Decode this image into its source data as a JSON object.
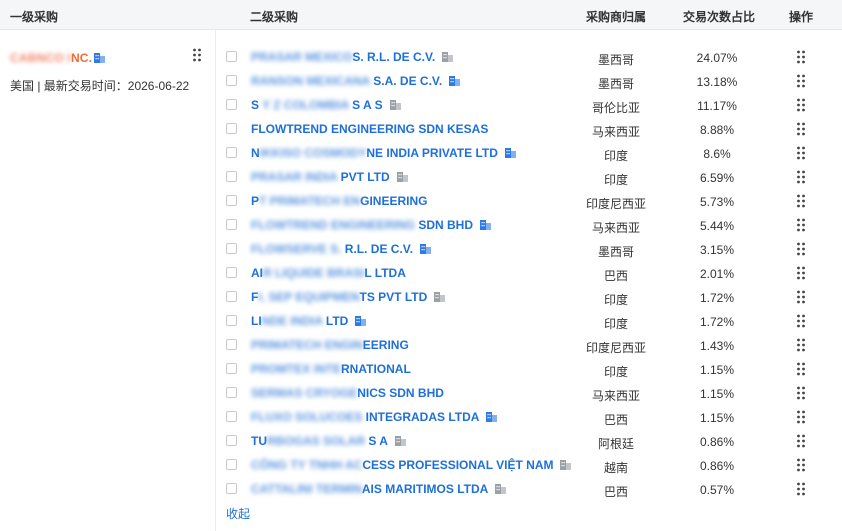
{
  "header": {
    "col_primary": "一级采购",
    "col_secondary": "二级采购",
    "col_country": "采购商归属",
    "col_share": "交易次数占比",
    "col_action": "操作"
  },
  "primary": {
    "name_hidden": "CABNCO I",
    "name_visible": "NC.",
    "meta": "美国 | 最新交易时间：2026-06-22"
  },
  "rows": [
    {
      "h1": "",
      "hidden": "PRASAR MEXICO",
      "visible": "S. R.L. DE C.V.",
      "country": "墨西哥",
      "pct": "24.07%",
      "icon": "gray"
    },
    {
      "h1": "",
      "hidden": "RANSON MEXICANA",
      "visible": " S.A. DE C.V.",
      "country": "墨西哥",
      "pct": "13.18%",
      "icon": "blue"
    },
    {
      "h1": "S",
      "hidden": " Y Z COLOMBIA",
      "visible": " S A S",
      "country": "哥伦比亚",
      "pct": "11.17%",
      "icon": "gray"
    },
    {
      "h1": "",
      "hidden": "",
      "visible": "FLOWTREND ENGINEERING SDN KESAS",
      "country": "马来西亚",
      "pct": "8.88%",
      "icon": ""
    },
    {
      "h1": "N",
      "hidden": "IKKISO COSMODY",
      "visible": "NE INDIA PRIVATE LTD",
      "country": "印度",
      "pct": "8.6%",
      "icon": "blue"
    },
    {
      "h1": "",
      "hidden": "PRASAR INDIA",
      "visible": " PVT LTD",
      "country": "印度",
      "pct": "6.59%",
      "icon": "gray"
    },
    {
      "h1": "P",
      "hidden": "T PRIMATECH EN",
      "visible": "GINEERING",
      "country": "印度尼西亚",
      "pct": "5.73%",
      "icon": ""
    },
    {
      "h1": "",
      "hidden": "FLOWTREND ENGINEERING",
      "visible": " SDN BHD",
      "country": "马来西亚",
      "pct": "5.44%",
      "icon": "blue"
    },
    {
      "h1": "",
      "hidden": "FLOWSERVE S.",
      "visible": " R.L. DE C.V.",
      "country": "墨西哥",
      "pct": "3.15%",
      "icon": "blue"
    },
    {
      "h1": "AI",
      "hidden": "R LIQUIDE BRASI",
      "visible": "L LTDA",
      "country": "巴西",
      "pct": "2.01%",
      "icon": ""
    },
    {
      "h1": "F",
      "hidden": "I. SEP EQUIPMEN",
      "visible": "TS PVT LTD",
      "country": "印度",
      "pct": "1.72%",
      "icon": "gray"
    },
    {
      "h1": "LI",
      "hidden": "NDE INDIA",
      "visible": " LTD",
      "country": "印度",
      "pct": "1.72%",
      "icon": "blue"
    },
    {
      "h1": "",
      "hidden": "PRIMATECH ENGIN",
      "visible": "EERING",
      "country": "印度尼西亚",
      "pct": "1.43%",
      "icon": ""
    },
    {
      "h1": "",
      "hidden": "PROMTEX INTE",
      "visible": "RNATIONAL",
      "country": "印度",
      "pct": "1.15%",
      "icon": ""
    },
    {
      "h1": "",
      "hidden": "SERMAS CRYOGE",
      "visible": "NICS SDN BHD",
      "country": "马来西亚",
      "pct": "1.15%",
      "icon": ""
    },
    {
      "h1": "",
      "hidden": "FLUXO SOLUCOES",
      "visible": " INTEGRADAS LTDA",
      "country": "巴西",
      "pct": "1.15%",
      "icon": "blue"
    },
    {
      "h1": "TU",
      "hidden": "RBOGAS SOLAR",
      "visible": " S A",
      "country": "阿根廷",
      "pct": "0.86%",
      "icon": "gray"
    },
    {
      "h1": "",
      "hidden": "CÔNG TY TNHH AC",
      "visible": "CESS PROFESSIONAL VIỆT NAM",
      "country": "越南",
      "pct": "0.86%",
      "icon": "gray"
    },
    {
      "h1": "",
      "hidden": "CATTALINI TERMIN",
      "visible": "AIS MARITIMOS LTDA",
      "country": "巴西",
      "pct": "0.57%",
      "icon": "gray"
    }
  ],
  "footer": {
    "collapse_label": "收起"
  },
  "colors": {
    "link": "#1e6fd9",
    "accent": "#f26b3a",
    "icon_blue": "#2f7be6",
    "icon_gray": "#9aa0a6"
  }
}
